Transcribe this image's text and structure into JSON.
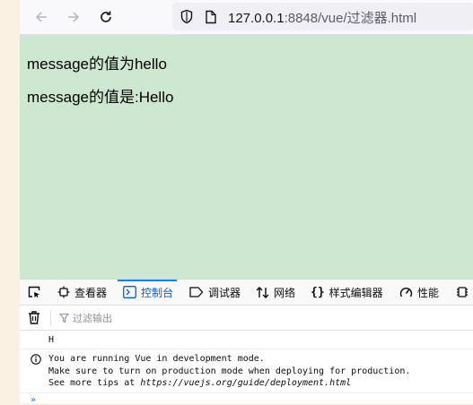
{
  "browser": {
    "url_host": "127.0.0.1",
    "url_rest": ":8848/vue/过滤器.html"
  },
  "page": {
    "line1": "message的值为hello",
    "line2": "message的值是:Hello"
  },
  "devtools": {
    "tabs": [
      {
        "label": "查看器",
        "icon": "inspector-icon"
      },
      {
        "label": "控制台",
        "icon": "console-icon",
        "active": true
      },
      {
        "label": "调试器",
        "icon": "debugger-icon"
      },
      {
        "label": "网络",
        "icon": "network-icon"
      },
      {
        "label": "样式编辑器",
        "icon": "style-editor-icon"
      },
      {
        "label": "性能",
        "icon": "performance-icon"
      }
    ],
    "filter_placeholder": "过滤输出",
    "console": {
      "log_h": "H",
      "info_line1": "You are running Vue in development mode.",
      "info_line2": "Make sure to turn on production mode when deploying for production.",
      "info_line3_prefix": "See more tips at ",
      "info_line3_url": "https://vuejs.org/guide/deployment.html",
      "prompt": "»"
    }
  }
}
